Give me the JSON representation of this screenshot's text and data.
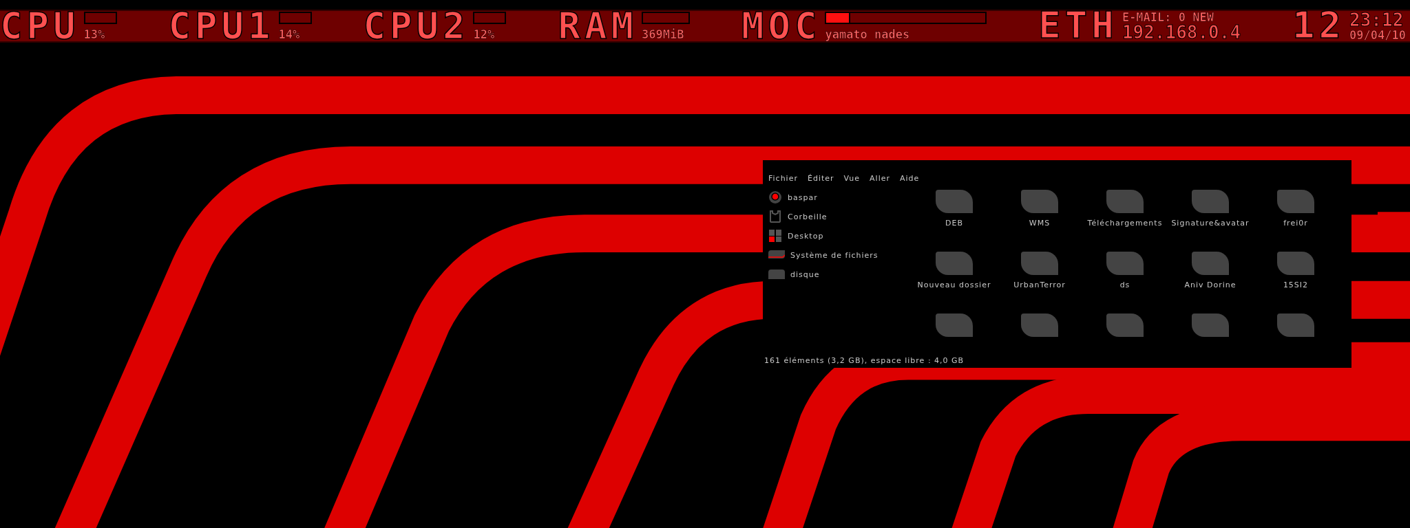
{
  "top_bar": {
    "items": [
      {
        "kind": "meter",
        "label": "CPU",
        "value": "13%"
      },
      {
        "kind": "meter",
        "label": "CPU1",
        "value": "14%"
      },
      {
        "kind": "meter",
        "label": "CPU2",
        "value": "12%"
      },
      {
        "kind": "meter",
        "label": "RAM",
        "value": "369MiB"
      },
      {
        "kind": "player",
        "label": "MOC",
        "value": "yamato nades",
        "level": 0.14
      },
      {
        "kind": "network",
        "label": "ETH",
        "lines": [
          "E-MAIL: 0 NEW",
          "192.168.0.4"
        ]
      },
      {
        "kind": "clock",
        "label": "12",
        "lines": [
          "23:12",
          "09/04/10"
        ]
      }
    ]
  },
  "file_manager": {
    "menu": [
      "Fichier",
      "Éditer",
      "Vue",
      "Aller",
      "Aide"
    ],
    "places": [
      {
        "kind": "home",
        "name": "baspar"
      },
      {
        "kind": "trash",
        "name": "Corbeille"
      },
      {
        "kind": "desktop",
        "name": "Desktop"
      },
      {
        "kind": "filesystem",
        "name": "Système de fichiers"
      },
      {
        "kind": "drive",
        "name": "disque"
      }
    ],
    "folders": [
      {
        "kind": "named",
        "name": "DEB"
      },
      {
        "kind": "named",
        "name": "WMS"
      },
      {
        "kind": "named",
        "name": "Téléchargements"
      },
      {
        "kind": "named",
        "name": "Signature&avatar"
      },
      {
        "kind": "named",
        "name": "frei0r"
      },
      {
        "kind": "named",
        "name": "Nouveau dossier"
      },
      {
        "kind": "named",
        "name": "UrbanTerror"
      },
      {
        "kind": "named",
        "name": "ds"
      },
      {
        "kind": "named",
        "name": "Aniv Dorine"
      },
      {
        "kind": "named",
        "name": "15SI2"
      },
      {
        "kind": "cut"
      },
      {
        "kind": "cut"
      },
      {
        "kind": "cut"
      },
      {
        "kind": "cut"
      },
      {
        "kind": "cut"
      }
    ],
    "status": "161 éléments (3,2 GB), espace libre : 4,0 GB"
  }
}
